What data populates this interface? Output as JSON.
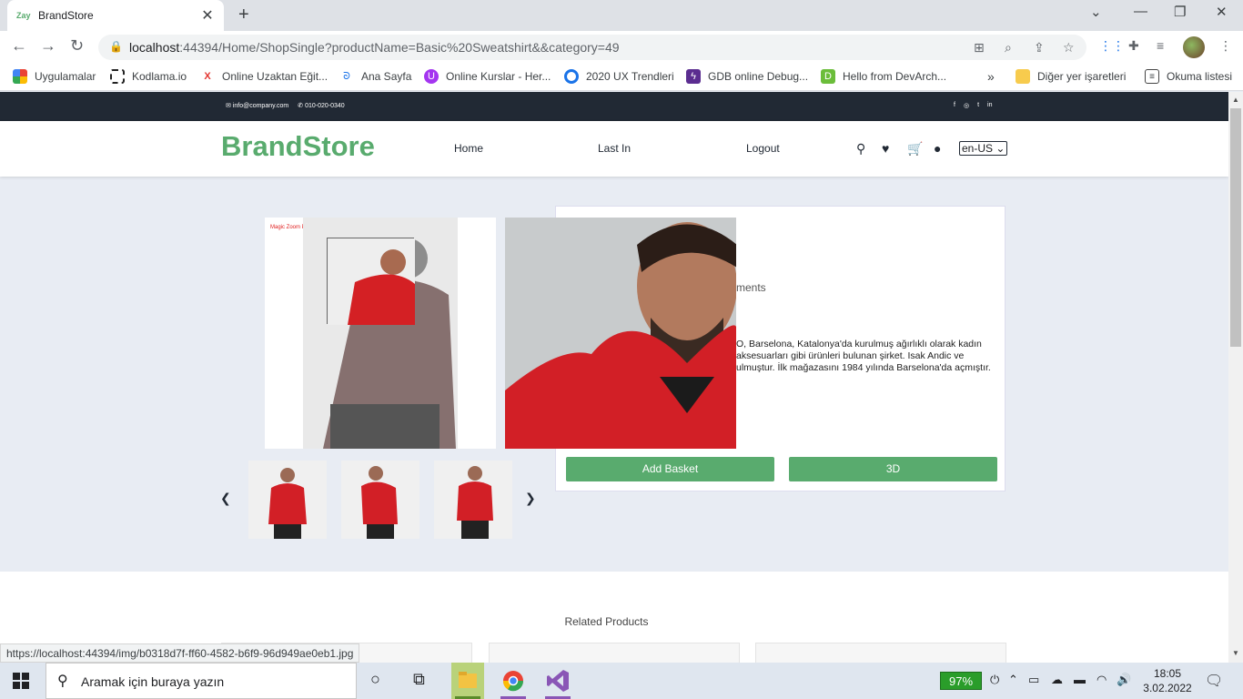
{
  "browser": {
    "tab_title": "BrandStore",
    "tab_favicon_text": "Zay",
    "url_host": "localhost",
    "url_rest": ":44394/Home/ShopSingle?productName=Basic%20Sweatshirt&&category=49",
    "status_url": "https://localhost:44394/img/b0318d7f-ff60-4582-b6f9-96d949ae0eb1.jpg"
  },
  "bookmarks": [
    {
      "label": "Uygulamalar",
      "icon": "apps-grid-icon"
    },
    {
      "label": "Kodlama.io",
      "icon": "kodlama-icon"
    },
    {
      "label": "Online Uzaktan Eğit...",
      "icon": "x-logo-icon"
    },
    {
      "label": "Ana Sayfa",
      "icon": "leaf-icon"
    },
    {
      "label": "Online Kurslar - Her...",
      "icon": "udemy-icon"
    },
    {
      "label": "2020 UX Trendleri",
      "icon": "circle-logo-icon"
    },
    {
      "label": "GDB online Debug...",
      "icon": "bolt-icon"
    },
    {
      "label": "Hello from DevArch...",
      "icon": "devarch-icon"
    }
  ],
  "bookmarks_overflow": "»",
  "other_bookmarks": "Diğer yer işaretleri",
  "reading_list": "Okuma listesi",
  "site": {
    "email": "info@company.com",
    "phone": "010-020-0340",
    "brand": "BrandStore",
    "nav": {
      "home": "Home",
      "last_in": "Last In",
      "logout": "Logout"
    },
    "language": "en-US"
  },
  "product": {
    "zoom_trial_text": "Magic Zoom Plus™ trial version",
    "category_fragment": "ments",
    "description_fragment": "O, Barselona, Katalonya'da kurulmuş ağırlıklı olarak kadın aksesuarları gibi ürünleri bulunan şirket. Isak Andic ve ulmuştur. İlk mağazasını 1984 yılında Barselona'da açmıştır.",
    "add_basket": "Add Basket",
    "three_d": "3D"
  },
  "related_title": "Related Products",
  "taskbar": {
    "search_placeholder": "Aramak için buraya yazın",
    "battery": "97%",
    "time": "18:05",
    "date": "3.02.2022"
  },
  "colors": {
    "brand_green": "#59ab6e",
    "topbar": "#212934"
  }
}
